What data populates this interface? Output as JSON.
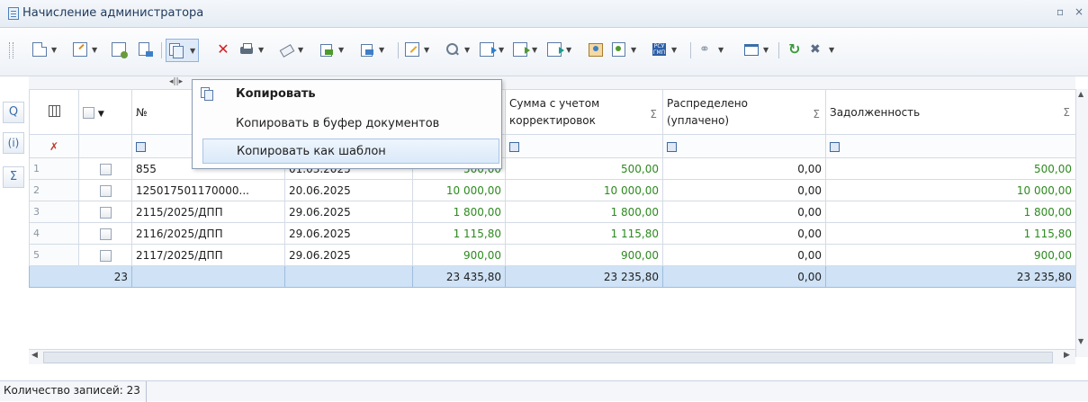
{
  "window": {
    "title": "Начисление администратора",
    "controls": [
      "▫",
      "×"
    ]
  },
  "menu": {
    "items": [
      {
        "label": "Копировать",
        "bold": true
      },
      {
        "label": "Копировать в буфер документов"
      },
      {
        "label": "Копировать как шаблон",
        "highlighted": true
      }
    ]
  },
  "grid": {
    "columns": {
      "num": "№",
      "date": "",
      "amount": "",
      "corrected": "Сумма с учетом корректировок",
      "paid": "Распределено (уплачено)",
      "debt": "Задолженность",
      "sigma": "Σ"
    },
    "rows": [
      {
        "rn": "1",
        "num": "855",
        "date": "01.03.2025",
        "amount": "500,00",
        "corrected": "500,00",
        "paid": "0,00",
        "debt": "500,00"
      },
      {
        "rn": "2",
        "num": "125017501170000...",
        "date": "20.06.2025",
        "amount": "10 000,00",
        "corrected": "10 000,00",
        "paid": "0,00",
        "debt": "10 000,00"
      },
      {
        "rn": "3",
        "num": "2115/2025/ДПП",
        "date": "29.06.2025",
        "amount": "1 800,00",
        "corrected": "1 800,00",
        "paid": "0,00",
        "debt": "1 800,00"
      },
      {
        "rn": "4",
        "num": "2116/2025/ДПП",
        "date": "29.06.2025",
        "amount": "1 115,80",
        "corrected": "1 115,80",
        "paid": "0,00",
        "debt": "1 115,80"
      },
      {
        "rn": "5",
        "num": "2117/2025/ДПП",
        "date": "29.06.2025",
        "amount": "900,00",
        "corrected": "900,00",
        "paid": "0,00",
        "debt": "900,00"
      }
    ],
    "totals": {
      "count": "23",
      "amount": "23 435,80",
      "corrected": "23 235,80",
      "paid": "0,00",
      "debt": "23 235,80"
    }
  },
  "sidebar": {
    "items": [
      "Q",
      "(i)",
      "Σ"
    ]
  },
  "status": {
    "records": "Количество записей: 23"
  },
  "colors": {
    "accent": "#3b6ea8",
    "green": "#2d8a1f",
    "total_row": "#cfe2f6",
    "delete": "#d42020"
  }
}
